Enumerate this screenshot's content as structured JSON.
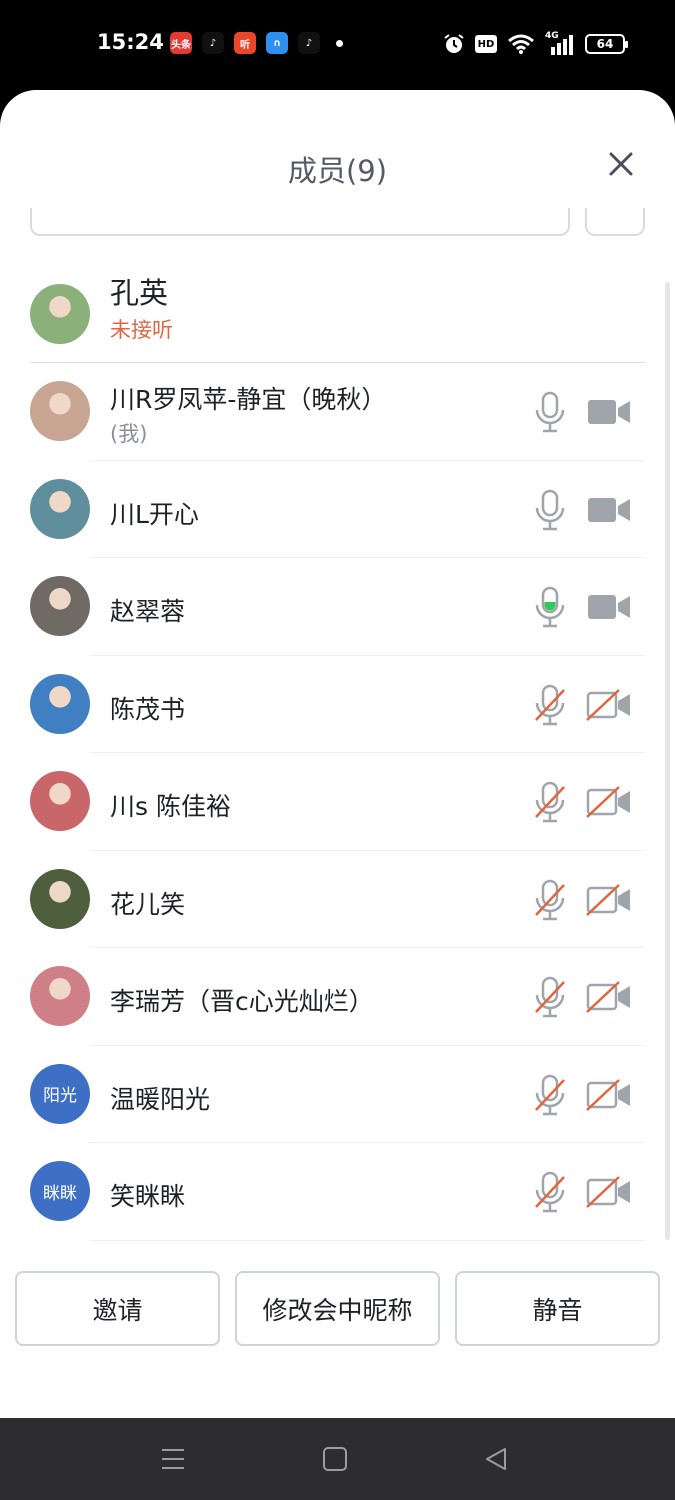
{
  "status_bar": {
    "time": "15:24",
    "battery": "64",
    "apps": [
      {
        "icon": "toutiao-icon",
        "label": "头条",
        "color": "#e33b34"
      },
      {
        "icon": "tiktok-icon",
        "label": "♪",
        "color": "#111111"
      },
      {
        "icon": "ting-icon",
        "label": "听",
        "color": "#e9462c"
      },
      {
        "icon": "app-blue-icon",
        "label": "∩",
        "color": "#2f8ff0"
      },
      {
        "icon": "tiktok-icon",
        "label": "♪",
        "color": "#111111"
      }
    ],
    "right_icons": [
      "alarm-icon",
      "hd-icon",
      "wifi-icon",
      "signal-4g-icon"
    ],
    "hd_label": "HD",
    "net_label": "4G"
  },
  "sheet": {
    "title": "成员(9)"
  },
  "members": [
    {
      "name": "孔英",
      "sub": "未接听",
      "sub_type": "missed",
      "avatar_color": "#8bb07a",
      "mic": "none",
      "cam": "none"
    },
    {
      "name": "川R罗凤苹-静宜（晚秋）",
      "sub": "(我)",
      "sub_type": "me",
      "avatar_color": "#c7a592",
      "mic": "on",
      "cam": "on"
    },
    {
      "name": "川L开心",
      "sub": "",
      "avatar_color": "#5f8f9c",
      "mic": "on",
      "cam": "on"
    },
    {
      "name": "赵翠蓉",
      "sub": "",
      "avatar_color": "#6f6a63",
      "mic": "speaking",
      "cam": "on"
    },
    {
      "name": "陈茂书",
      "sub": "",
      "avatar_color": "#3f7fc2",
      "mic": "off",
      "cam": "off"
    },
    {
      "name": "川s 陈佳裕",
      "sub": "",
      "avatar_color": "#c9666a",
      "mic": "off",
      "cam": "off"
    },
    {
      "name": "花儿笑",
      "sub": "",
      "avatar_color": "#4d5f3d",
      "mic": "off",
      "cam": "off"
    },
    {
      "name": "李瑞芳（晋c心光灿烂）",
      "sub": "",
      "avatar_color": "#cf7f88",
      "mic": "off",
      "cam": "off"
    },
    {
      "name": "温暖阳光",
      "sub": "",
      "avatar_text": "阳光",
      "mic": "off",
      "cam": "off"
    },
    {
      "name": "笑眯眯",
      "sub": "",
      "avatar_text": "眯眯",
      "mic": "off",
      "cam": "off"
    }
  ],
  "actions": {
    "invite": "邀请",
    "rename": "修改会中昵称",
    "mute": "静音"
  },
  "colors": {
    "accent_blue": "#3d6fc4",
    "missed_orange": "#e0663f",
    "speaking_green": "#34c759",
    "muted_red": "#e0663f",
    "icon_gray": "#8a8f99"
  }
}
